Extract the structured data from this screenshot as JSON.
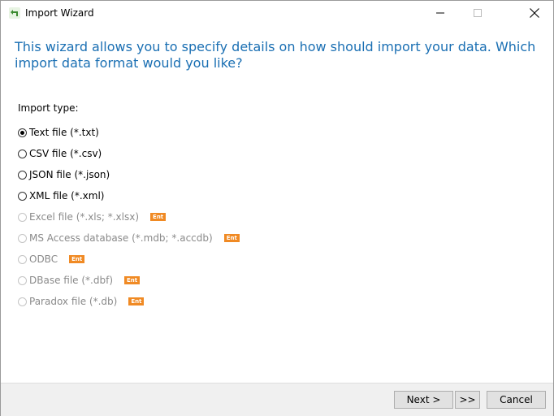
{
  "window": {
    "title": "Import Wizard",
    "icon": "import-arrow-icon"
  },
  "heading": "This wizard allows you to specify details on how should import your data. Which import data format would you like?",
  "import_type_label": "Import type:",
  "options": [
    {
      "label": "Text file (*.txt)",
      "checked": true,
      "enabled": true
    },
    {
      "label": "CSV file (*.csv)",
      "checked": false,
      "enabled": true
    },
    {
      "label": "JSON file (*.json)",
      "checked": false,
      "enabled": true
    },
    {
      "label": "XML file (*.xml)",
      "checked": false,
      "enabled": true
    },
    {
      "label": "Excel file (*.xls; *.xlsx)",
      "checked": false,
      "enabled": false,
      "badge": "Ent"
    },
    {
      "label": "MS Access database (*.mdb; *.accdb)",
      "checked": false,
      "enabled": false,
      "badge": "Ent"
    },
    {
      "label": "ODBC",
      "checked": false,
      "enabled": false,
      "badge": "Ent"
    },
    {
      "label": "DBase file (*.dbf)",
      "checked": false,
      "enabled": false,
      "badge": "Ent"
    },
    {
      "label": "Paradox file (*.db)",
      "checked": false,
      "enabled": false,
      "badge": "Ent"
    }
  ],
  "buttons": {
    "next": "Next >",
    "skip": ">>",
    "cancel": "Cancel"
  },
  "colors": {
    "heading": "#1a6fb3",
    "badge": "#f08a24",
    "footer": "#f0f0f0"
  }
}
